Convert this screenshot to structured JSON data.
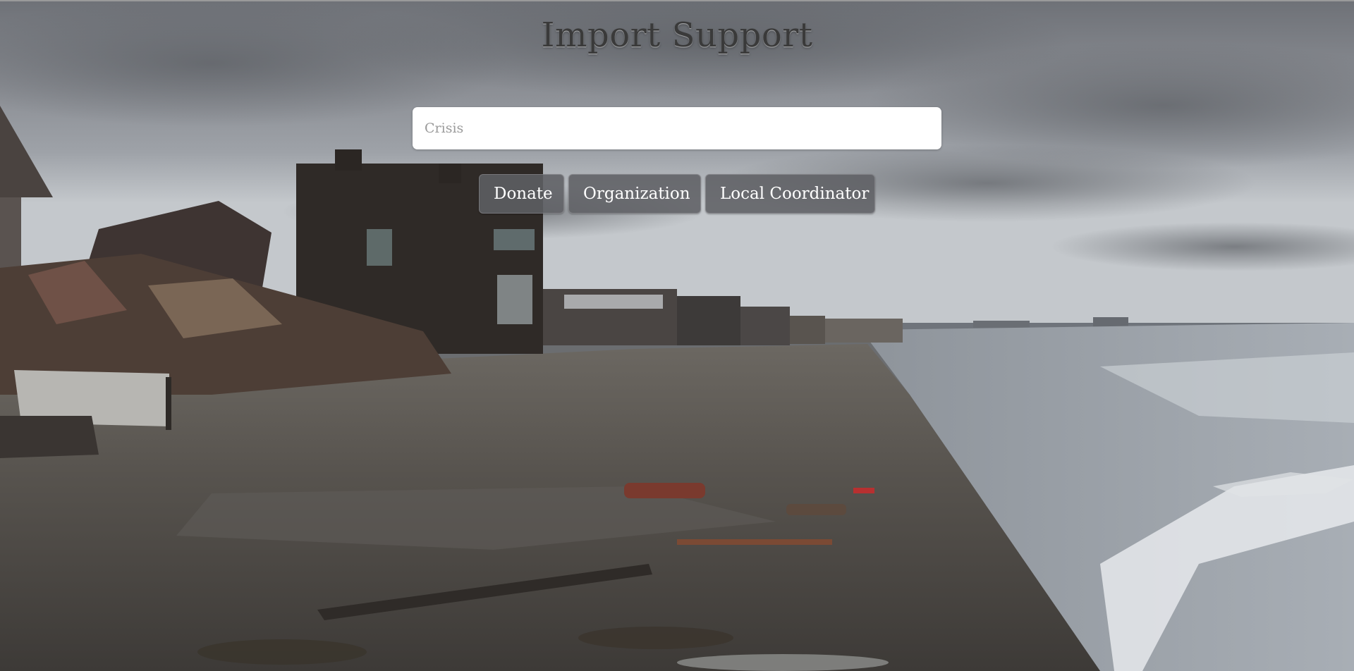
{
  "app": {
    "title": "Import Support"
  },
  "search": {
    "placeholder": "Crisis",
    "value": ""
  },
  "actions": {
    "donate_label": "Donate",
    "organization_label": "Organization",
    "local_coordinator_label": "Local Coordinator"
  },
  "background": {
    "image": "stormy-beach-wrecked-houses-photo",
    "sky_color": "#8a8d92",
    "sand_color": "#4d4a46",
    "water_color": "#9da3aa"
  }
}
